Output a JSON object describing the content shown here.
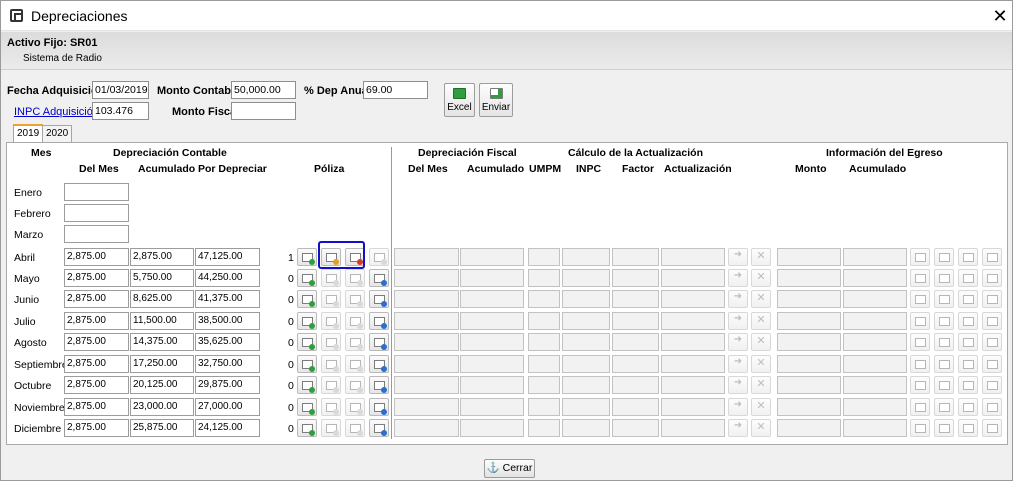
{
  "window": {
    "title": "Depreciaciones",
    "close_glyph": "✕"
  },
  "header": {
    "asset_label": "Activo Fijo: SR01",
    "asset_description": "Sistema de Radio"
  },
  "form": {
    "fecha_adq_label": "Fecha Adquisición",
    "fecha_adq_value": "01/03/2019",
    "monto_contable_label": "Monto Contable",
    "monto_contable_value": "50,000.00",
    "dep_anual_label": "% Dep Anual",
    "dep_anual_value": "69.00",
    "inpc_label": "INPC Adquisición",
    "inpc_value": "103.476",
    "monto_fiscal_label": "Monto Fiscal",
    "monto_fiscal_value": ""
  },
  "toolbar": {
    "excel_label": "Excel",
    "enviar_label": "Enviar"
  },
  "tabs": [
    {
      "label": "2019",
      "selected": true
    },
    {
      "label": "2020",
      "selected": false
    }
  ],
  "columns": {
    "mes": "Mes",
    "dep_contable": "Depreciación Contable",
    "del_mes": "Del Mes",
    "acumulado": "Acumulado",
    "por_depreciar": "Por Depreciar",
    "poliza": "Póliza",
    "dep_fiscal": "Depreciación Fiscal",
    "fiscal_del_mes": "Del Mes",
    "fiscal_acumulado": "Acumulado",
    "calculo_actualizacion": "Cálculo de la Actualización",
    "umpm": "UMPM",
    "inpc": "INPC",
    "factor": "Factor",
    "actualizacion": "Actualización",
    "info_egreso": "Información del Egreso",
    "monto": "Monto",
    "egreso_acumulado": "Acumulado"
  },
  "months": [
    {
      "name": "Enero",
      "del_mes": "",
      "acumulado": "",
      "por_depreciar": "",
      "poliza": "",
      "active": false
    },
    {
      "name": "Febrero",
      "del_mes": "",
      "acumulado": "",
      "por_depreciar": "",
      "poliza": "",
      "active": false
    },
    {
      "name": "Marzo",
      "del_mes": "",
      "acumulado": "",
      "por_depreciar": "",
      "poliza": "",
      "active": false
    },
    {
      "name": "Abril",
      "del_mes": "2,875.00",
      "acumulado": "2,875.00",
      "por_depreciar": "47,125.00",
      "poliza": "1",
      "active": true
    },
    {
      "name": "Mayo",
      "del_mes": "2,875.00",
      "acumulado": "5,750.00",
      "por_depreciar": "44,250.00",
      "poliza": "0",
      "active": true
    },
    {
      "name": "Junio",
      "del_mes": "2,875.00",
      "acumulado": "8,625.00",
      "por_depreciar": "41,375.00",
      "poliza": "0",
      "active": true
    },
    {
      "name": "Julio",
      "del_mes": "2,875.00",
      "acumulado": "11,500.00",
      "por_depreciar": "38,500.00",
      "poliza": "0",
      "active": true
    },
    {
      "name": "Agosto",
      "del_mes": "2,875.00",
      "acumulado": "14,375.00",
      "por_depreciar": "35,625.00",
      "poliza": "0",
      "active": true
    },
    {
      "name": "Septiembre",
      "del_mes": "2,875.00",
      "acumulado": "17,250.00",
      "por_depreciar": "32,750.00",
      "poliza": "0",
      "active": true
    },
    {
      "name": "Octubre",
      "del_mes": "2,875.00",
      "acumulado": "20,125.00",
      "por_depreciar": "29,875.00",
      "poliza": "0",
      "active": true
    },
    {
      "name": "Noviembre",
      "del_mes": "2,875.00",
      "acumulado": "23,000.00",
      "por_depreciar": "27,000.00",
      "poliza": "0",
      "active": true
    },
    {
      "name": "Diciembre",
      "del_mes": "2,875.00",
      "acumulado": "25,875.00",
      "por_depreciar": "24,125.00",
      "poliza": "0",
      "active": true
    }
  ],
  "poliza_icons": [
    "new-poliza-icon",
    "edit-poliza-icon",
    "delete-poliza-icon",
    "print-poliza-icon"
  ],
  "egreso_icons": [
    "new-egreso-icon",
    "edit-egreso-icon",
    "delete-egreso-icon",
    "print-egreso-icon"
  ],
  "row_action_icons": [
    "apply-arrow-icon",
    "clear-x-icon"
  ],
  "footer": {
    "cerrar_label": "Cerrar",
    "cerrar_icon": "anchor-icon"
  },
  "colors": {
    "accent_green": "#2e9e3e",
    "accent_red": "#d43a2a",
    "highlight": "#1010c8",
    "tab_accent": "#f0a030"
  }
}
